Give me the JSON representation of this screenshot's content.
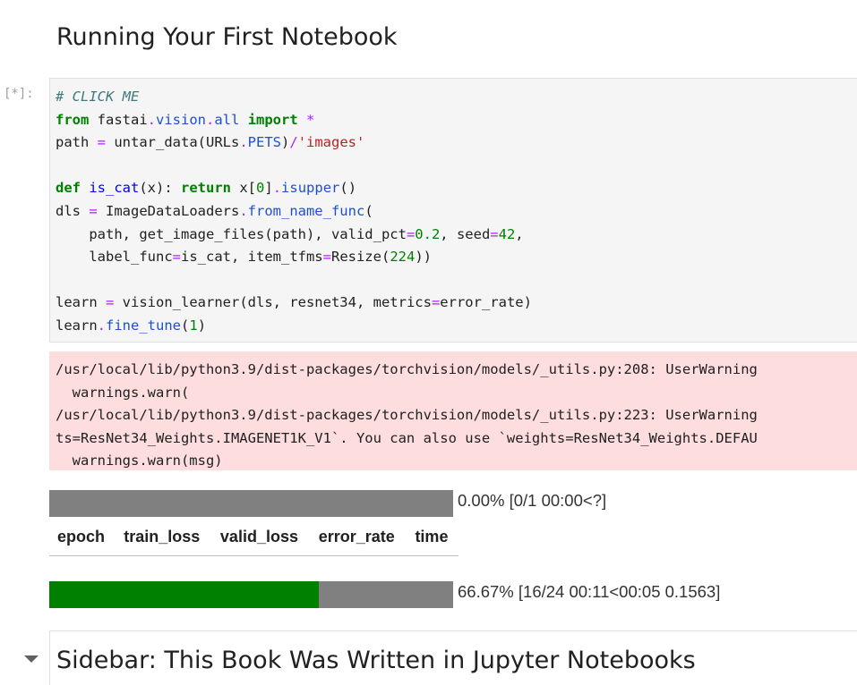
{
  "heading": "Running Your First Notebook",
  "cell": {
    "prompt": "[*]:",
    "code": [
      [
        {
          "t": "# CLICK ME",
          "c": "cm"
        }
      ],
      [
        {
          "t": "from",
          "c": "kw"
        },
        {
          "t": " fastai"
        },
        {
          "t": ".",
          "c": "op"
        },
        {
          "t": "vision",
          "c": "at"
        },
        {
          "t": ".",
          "c": "op"
        },
        {
          "t": "all",
          "c": "at"
        },
        {
          "t": " "
        },
        {
          "t": "import",
          "c": "kw"
        },
        {
          "t": " "
        },
        {
          "t": "*",
          "c": "op"
        }
      ],
      [
        {
          "t": "path "
        },
        {
          "t": "=",
          "c": "op"
        },
        {
          "t": " untar_data(URLs"
        },
        {
          "t": ".",
          "c": "op"
        },
        {
          "t": "PETS",
          "c": "at"
        },
        {
          "t": ")"
        },
        {
          "t": "/",
          "c": "op"
        },
        {
          "t": "'images'",
          "c": "st"
        }
      ],
      [],
      [
        {
          "t": "def",
          "c": "kw"
        },
        {
          "t": " "
        },
        {
          "t": "is_cat",
          "c": "fn"
        },
        {
          "t": "(x): "
        },
        {
          "t": "return",
          "c": "kw"
        },
        {
          "t": " x["
        },
        {
          "t": "0",
          "c": "nu"
        },
        {
          "t": "]"
        },
        {
          "t": ".",
          "c": "op"
        },
        {
          "t": "isupper",
          "c": "at"
        },
        {
          "t": "()"
        }
      ],
      [
        {
          "t": "dls "
        },
        {
          "t": "=",
          "c": "op"
        },
        {
          "t": " ImageDataLoaders"
        },
        {
          "t": ".",
          "c": "op"
        },
        {
          "t": "from_name_func",
          "c": "at"
        },
        {
          "t": "("
        }
      ],
      [
        {
          "t": "    path, get_image_files(path), valid_pct"
        },
        {
          "t": "=",
          "c": "op"
        },
        {
          "t": "0.2",
          "c": "nu"
        },
        {
          "t": ", seed"
        },
        {
          "t": "=",
          "c": "op"
        },
        {
          "t": "42",
          "c": "nu"
        },
        {
          "t": ","
        }
      ],
      [
        {
          "t": "    label_func"
        },
        {
          "t": "=",
          "c": "op"
        },
        {
          "t": "is_cat, item_tfms"
        },
        {
          "t": "=",
          "c": "op"
        },
        {
          "t": "Resize("
        },
        {
          "t": "224",
          "c": "nu"
        },
        {
          "t": "))"
        }
      ],
      [],
      [
        {
          "t": "learn "
        },
        {
          "t": "=",
          "c": "op"
        },
        {
          "t": " vision_learner(dls, resnet34, metrics"
        },
        {
          "t": "=",
          "c": "op"
        },
        {
          "t": "error_rate)"
        }
      ],
      [
        {
          "t": "learn"
        },
        {
          "t": ".",
          "c": "op"
        },
        {
          "t": "fine_tune",
          "c": "at"
        },
        {
          "t": "("
        },
        {
          "t": "1",
          "c": "nu"
        },
        {
          "t": ")"
        }
      ]
    ]
  },
  "stderr": [
    "/usr/local/lib/python3.9/dist-packages/torchvision/models/_utils.py:208: UserWarning",
    "  warnings.warn(",
    "/usr/local/lib/python3.9/dist-packages/torchvision/models/_utils.py:223: UserWarning",
    "ts=ResNet34_Weights.IMAGENET1K_V1`. You can also use `weights=ResNet34_Weights.DEFAU",
    "  warnings.warn(msg)"
  ],
  "epoch_progress": {
    "fraction": 0.0,
    "label": "0.00% [0/1 00:00<?]"
  },
  "metrics_table": {
    "columns": [
      "epoch",
      "train_loss",
      "valid_loss",
      "error_rate",
      "time"
    ]
  },
  "batch_progress": {
    "fraction": 0.6667,
    "label": "66.67% [16/24 00:11<00:05 0.1563]"
  },
  "next_heading": "Sidebar: This Book Was Written in Jupyter Notebooks",
  "colors": {
    "progress_fill": "#008000",
    "progress_track": "#808080",
    "stderr_bg": "#fddddd"
  }
}
